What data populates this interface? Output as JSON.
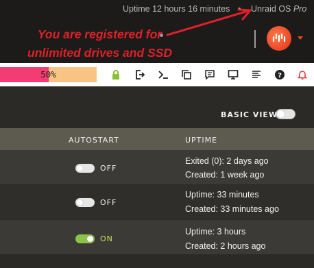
{
  "header": {
    "uptime": "Uptime 12 hours 16 minutes",
    "separator": "•",
    "os_name": "Unraid OS",
    "os_edition": "Pro",
    "promo_line1": "You are registered for",
    "promo_line2": "unlimited drives and SSD",
    "promo_color": "#e0202a",
    "logo_icon": "unraid-logo-icon",
    "menu_icon": "caret-down-icon"
  },
  "toolbar": {
    "progress_value": 0.5,
    "progress_label": "50%",
    "progress_fill_color": "#f43c74",
    "progress_track_color": "#f8c483",
    "icons": [
      "lock-icon",
      "logout-icon",
      "terminal-icon",
      "copy-window-icon",
      "feedback-icon",
      "display-icon",
      "log-icon",
      "help-icon",
      "bell-icon"
    ]
  },
  "view": {
    "basic_view_label": "BASIC VIEW",
    "basic_view_on": false
  },
  "table": {
    "headers": {
      "autostart": "AUTOSTART",
      "uptime": "UPTIME"
    },
    "rows": [
      {
        "autostart_on": false,
        "autostart_label": "OFF",
        "status": "Exited (0): 2 days ago",
        "created": "Created: 1 week ago"
      },
      {
        "autostart_on": false,
        "autostart_label": "OFF",
        "status": "Uptime: 33 minutes",
        "created": "Created: 33 minutes ago"
      },
      {
        "autostart_on": true,
        "autostart_label": "ON",
        "status": "Uptime: 3 hours",
        "created": "Created: 2 hours ago"
      }
    ]
  }
}
